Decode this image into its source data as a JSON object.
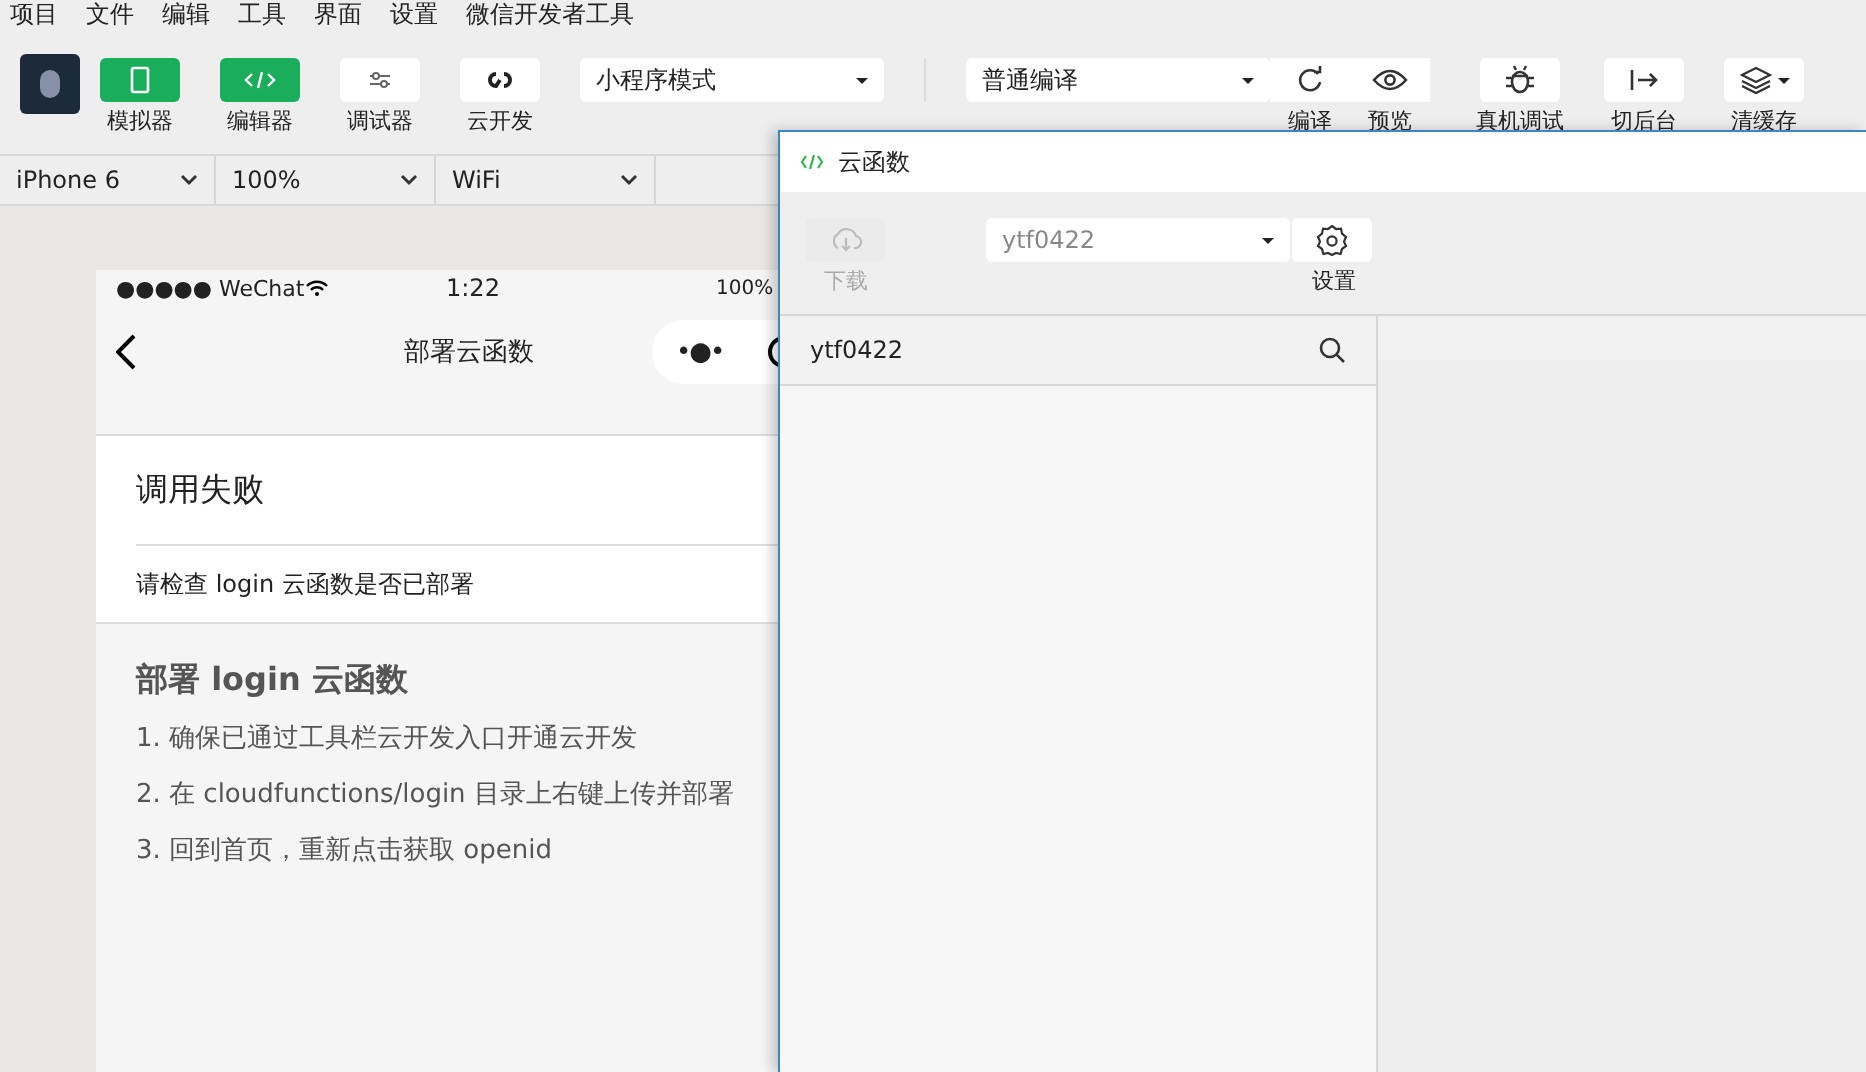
{
  "menu": [
    "项目",
    "文件",
    "编辑",
    "工具",
    "界面",
    "设置",
    "微信开发者工具"
  ],
  "toolbar": {
    "left_buttons": [
      {
        "label": "模拟器",
        "kind": "phone",
        "on": true
      },
      {
        "label": "编辑器",
        "kind": "code",
        "on": true
      },
      {
        "label": "调试器",
        "kind": "sliders",
        "on": false
      },
      {
        "label": "云开发",
        "kind": "link",
        "on": false
      }
    ],
    "mode_select": "小程序模式",
    "compile_select": "普通编译",
    "right_buttons": [
      {
        "label": "编译",
        "kind": "refresh"
      },
      {
        "label": "预览",
        "kind": "eye"
      },
      {
        "label": "真机调试",
        "kind": "bug"
      },
      {
        "label": "切后台",
        "kind": "exit"
      },
      {
        "label": "清缓存",
        "kind": "layers"
      }
    ]
  },
  "device_bar": [
    "iPhone 6",
    "100%",
    "WiFi"
  ],
  "phone": {
    "status": {
      "carrier": "●●●●● WeChat",
      "time": "1:22",
      "battery": "100%"
    },
    "nav_title": "部署云函数",
    "capsule": "•●•",
    "error_title": "调用失败",
    "error_message": "请检查 login 云函数是否已部署",
    "guide_title": "部署 login 云函数",
    "steps": [
      "1. 确保已通过工具栏云开发入口开通云开发",
      "2. 在 cloudfunctions/login 目录上右键上传并部署",
      "3. 回到首页，重新点击获取 openid"
    ]
  },
  "cloud_window": {
    "title": "云函数",
    "download": {
      "label": "下载",
      "disabled": true
    },
    "env_select": "ytf0422",
    "settings": "设置",
    "search": "ytf0422"
  }
}
